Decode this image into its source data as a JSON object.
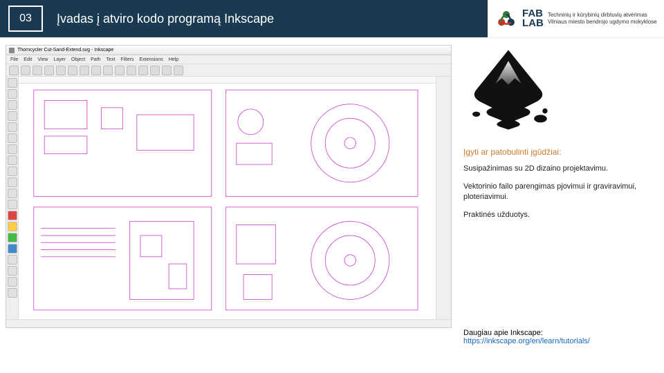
{
  "header": {
    "slide_number": "03",
    "title": "Įvadas į atviro kodo programą Inkscape",
    "logo_text_line1": "FAB",
    "logo_text_line2": "LAB",
    "logo_description": "Techninių ir kūrybinių dirbtuvių atvėrimas Vilniaus miesto bendrojo ugdymo mokyklose"
  },
  "screenshot": {
    "window_title": "Thorncycler Cut-Sand-Extend.svg - Inkscape",
    "menus": [
      "File",
      "Edit",
      "View",
      "Layer",
      "Object",
      "Path",
      "Text",
      "Filters",
      "Extensions",
      "Help"
    ]
  },
  "sidebar": {
    "skills_heading": "Įgyti ar patobulinti įgūdžiai:",
    "skills": [
      "Susipažinimas su 2D dizaino projektavimu.",
      "Vektorinio failo parengimas pjovimui ir graviravimui, ploteriavimui.",
      "Praktinės užduotys."
    ],
    "more_label": "Daugiau apie Inkscape:",
    "more_url": "https://inkscape.org/en/learn/tutorials/"
  }
}
